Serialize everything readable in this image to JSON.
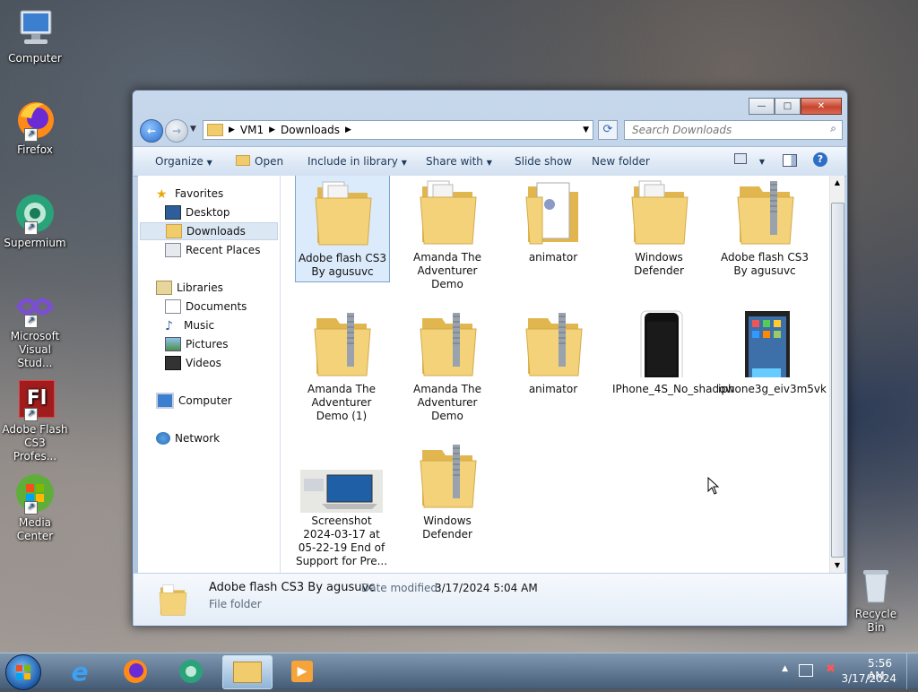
{
  "desktop": {
    "icons": [
      {
        "label": "Computer"
      },
      {
        "label": "Firefox"
      },
      {
        "label": "Supermium"
      },
      {
        "label": "Microsoft Visual Stud..."
      },
      {
        "label": "Adobe Flash CS3 Profes..."
      },
      {
        "label": "Media Center"
      },
      {
        "label": "Recycle Bin"
      }
    ],
    "flash_glyph": "Fl"
  },
  "window": {
    "breadcrumb": [
      "VM1",
      "Downloads"
    ],
    "search_placeholder": "Search Downloads",
    "toolbar": {
      "organize": "Organize",
      "open": "Open",
      "include": "Include in library",
      "share": "Share with",
      "slideshow": "Slide show",
      "newfolder": "New folder"
    },
    "nav": {
      "favorites": "Favorites",
      "desktop": "Desktop",
      "downloads": "Downloads",
      "recent": "Recent Places",
      "libraries": "Libraries",
      "documents": "Documents",
      "music": "Music",
      "pictures": "Pictures",
      "videos": "Videos",
      "computer": "Computer",
      "network": "Network"
    },
    "items": [
      {
        "name": "Adobe flash CS3 By agusuvc",
        "type": "folder",
        "selected": true
      },
      {
        "name": "Amanda The Adventurer Demo",
        "type": "folder"
      },
      {
        "name": "animator",
        "type": "folder-doc"
      },
      {
        "name": "Windows Defender",
        "type": "folder"
      },
      {
        "name": "Adobe flash CS3 By agusuvc",
        "type": "zip"
      },
      {
        "name": "Amanda The Adventurer Demo (1)",
        "type": "zip"
      },
      {
        "name": "Amanda The Adventurer Demo",
        "type": "zip"
      },
      {
        "name": "animator",
        "type": "zip"
      },
      {
        "name": "IPhone_4S_No_shadow",
        "type": "image-phone"
      },
      {
        "name": "iphone3g_eiv3m5vk",
        "type": "image-phone-color"
      },
      {
        "name": "Screenshot 2024-03-17 at 05-22-19 End of Support for Pre...",
        "type": "image-laptop"
      },
      {
        "name": "Windows Defender",
        "type": "zip"
      }
    ],
    "details": {
      "name": "Adobe flash CS3 By agusuvc",
      "date_label": "Date modified:",
      "date": "3/17/2024 5:04 AM",
      "type": "File folder"
    }
  },
  "taskbar": {
    "time": "5:56 AM",
    "date": "3/17/2024"
  },
  "colors": {
    "folder": "#f3d27a",
    "selection": "#dcebfc",
    "toolbar_text": "#1e395b"
  }
}
